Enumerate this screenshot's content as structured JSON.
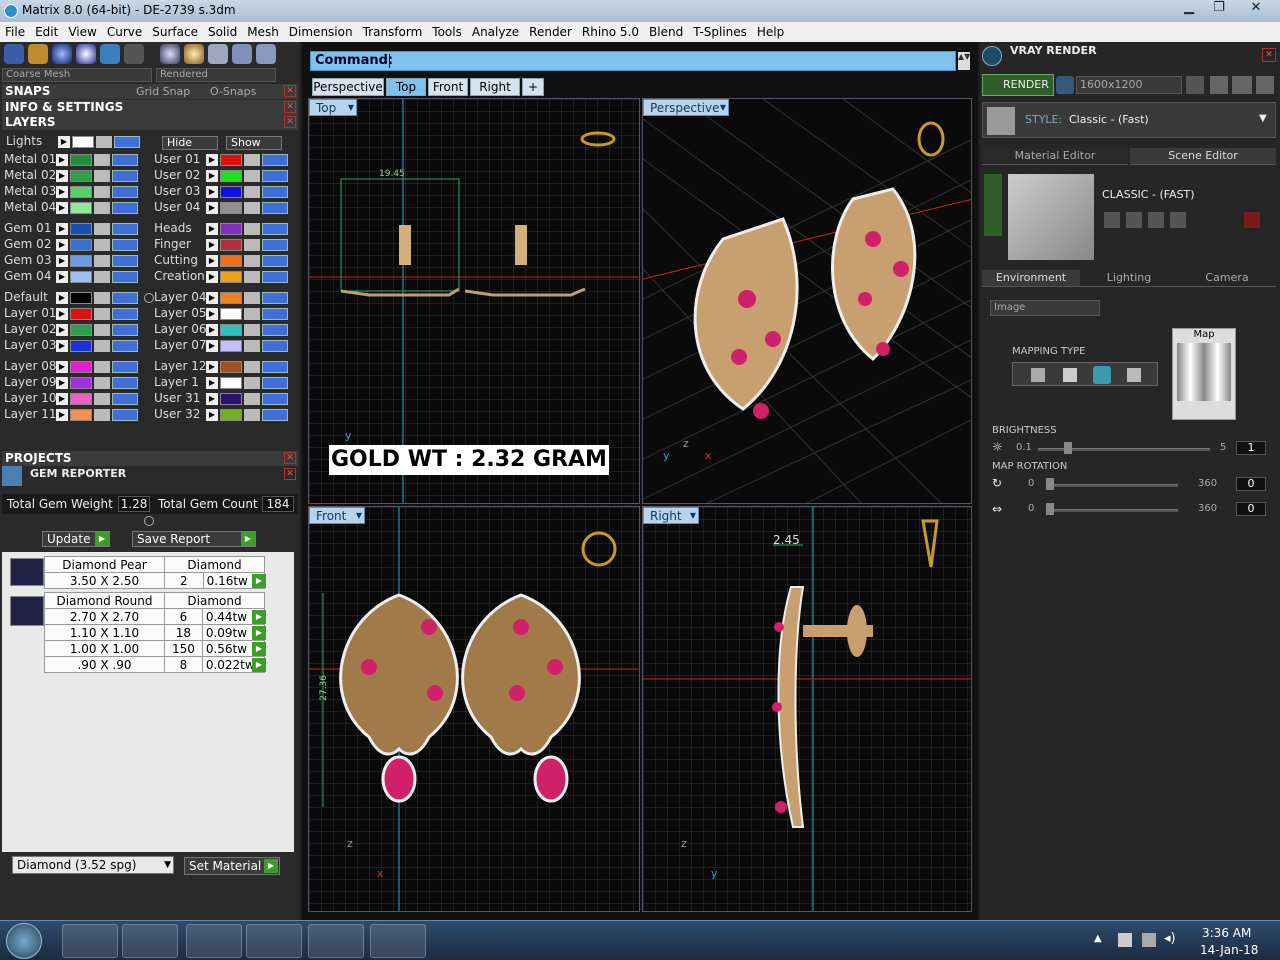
{
  "window": {
    "title": "Matrix 8.0 (64-bit) - DE-2739 s.3dm"
  },
  "menu": [
    "File",
    "Edit",
    "View",
    "Curve",
    "Surface",
    "Solid",
    "Mesh",
    "Dimension",
    "Transform",
    "Tools",
    "Analyze",
    "Render",
    "Rhino 5.0",
    "Blend",
    "T-Splines",
    "Help"
  ],
  "left": {
    "mesh_combo": "Coarse Mesh",
    "render_combo": "Rendered",
    "snaps": {
      "title": "SNAPS",
      "grid": "Grid Snap",
      "osnaps": "O-Snaps"
    },
    "info_title": "INFO & SETTINGS",
    "layers_title": "LAYERS",
    "lights": "Lights",
    "hide": "Hide",
    "show": "Show",
    "layers_col1": [
      {
        "name": "Metal 01",
        "color": "#1f8f3a"
      },
      {
        "name": "Metal 02",
        "color": "#2fa04a"
      },
      {
        "name": "Metal 03",
        "color": "#5ad06a"
      },
      {
        "name": "Metal 04",
        "color": "#8ee89a"
      },
      {
        "name": "Gem 01",
        "color": "#1a4fb0"
      },
      {
        "name": "Gem 02",
        "color": "#3a70d0"
      },
      {
        "name": "Gem 03",
        "color": "#6b9ae8"
      },
      {
        "name": "Gem 04",
        "color": "#9fc0f5"
      },
      {
        "name": "Default",
        "color": "#000000"
      },
      {
        "name": "Layer 01",
        "color": "#e01010"
      },
      {
        "name": "Layer 02",
        "color": "#2fa04a"
      },
      {
        "name": "Layer 03",
        "color": "#1a2fe0"
      },
      {
        "name": "Layer 08",
        "color": "#e01fd0"
      },
      {
        "name": "Layer 09",
        "color": "#a030e0"
      },
      {
        "name": "Layer 10",
        "color": "#f060c0"
      },
      {
        "name": "Layer 11",
        "color": "#f59050"
      }
    ],
    "layers_col2": [
      {
        "name": "User 01",
        "color": "#e01010"
      },
      {
        "name": "User 02",
        "color": "#1fe01f"
      },
      {
        "name": "User 03",
        "color": "#1010e0"
      },
      {
        "name": "User 04",
        "color": "#909090"
      },
      {
        "name": "Heads",
        "color": "#8030c0"
      },
      {
        "name": "Finger",
        "color": "#b03040"
      },
      {
        "name": "Cutting",
        "color": "#f07020"
      },
      {
        "name": "Creation",
        "color": "#f0a020"
      },
      {
        "name": "Layer 04",
        "color": "#f08020"
      },
      {
        "name": "Layer 05",
        "color": "#ffffff"
      },
      {
        "name": "Layer 06",
        "color": "#30c0c0"
      },
      {
        "name": "Layer 07",
        "color": "#c0c0ff"
      },
      {
        "name": "Layer 12",
        "color": "#a05020"
      },
      {
        "name": "Layer 1",
        "color": "#ffffff"
      },
      {
        "name": "User 31",
        "color": "#301070"
      },
      {
        "name": "User 32",
        "color": "#70b020"
      }
    ],
    "projects_title": "PROJECTS",
    "gem_reporter": "GEM REPORTER",
    "total_weight_label": "Total Gem Weight",
    "total_weight": "1.28",
    "total_count_label": "Total Gem Count",
    "total_count": "184",
    "update": "Update",
    "save_report": "Save Report",
    "pear": {
      "shape": "Diamond Pear",
      "type": "Diamond",
      "rows": [
        {
          "size": "3.50 X 2.50",
          "qty": "2",
          "wt": "0.16tw"
        }
      ]
    },
    "round": {
      "shape": "Diamond Round",
      "type": "Diamond",
      "rows": [
        {
          "size": "2.70 X 2.70",
          "qty": "6",
          "wt": "0.44tw"
        },
        {
          "size": "1.10 X 1.10",
          "qty": "18",
          "wt": "0.09tw"
        },
        {
          "size": "1.00 X 1.00",
          "qty": "150",
          "wt": "0.56tw"
        },
        {
          "size": ".90 X .90",
          "qty": "8",
          "wt": "0.022tw"
        }
      ]
    },
    "material_select": "Diamond     (3.52 spg)",
    "set_material": "Set Material"
  },
  "center": {
    "command_label": "Command:",
    "tabs": [
      "Perspective",
      "Top",
      "Front",
      "Right",
      "+"
    ],
    "viewports": {
      "top": "Top",
      "persp": "Perspective",
      "front": "Front",
      "right": "Right"
    },
    "gold_wt": "GOLD WT : 2.32 GRAM",
    "dim_top": "19.45",
    "dim_front": "27.36",
    "dim_right": "2.45",
    "axis": {
      "x": "x",
      "y": "y",
      "z": "z"
    }
  },
  "right": {
    "title": "VRAY RENDER",
    "render_btn": "RENDER",
    "resolution": "1600x1200",
    "style_label": "STYLE:",
    "style_value": "Classic - (Fast)",
    "tab_material": "Material Editor",
    "tab_scene": "Scene Editor",
    "preset_name": "CLASSIC - (FAST)",
    "tab_env": "Environment",
    "tab_light": "Lighting",
    "tab_cam": "Camera",
    "image_combo": "Image",
    "map_label": "Map",
    "mapping_type": "MAPPING TYPE",
    "brightness": "BRIGHTNESS",
    "bright_min": "0.1",
    "bright_max": "5",
    "bright_val": "1",
    "map_rotation": "MAP ROTATION",
    "rot_min1": "0",
    "rot_max1": "360",
    "rot_val1": "0",
    "rot_min2": "0",
    "rot_max2": "360",
    "rot_val2": "0"
  },
  "taskbar": {
    "time": "3:36 AM",
    "date": "14-Jan-18"
  }
}
